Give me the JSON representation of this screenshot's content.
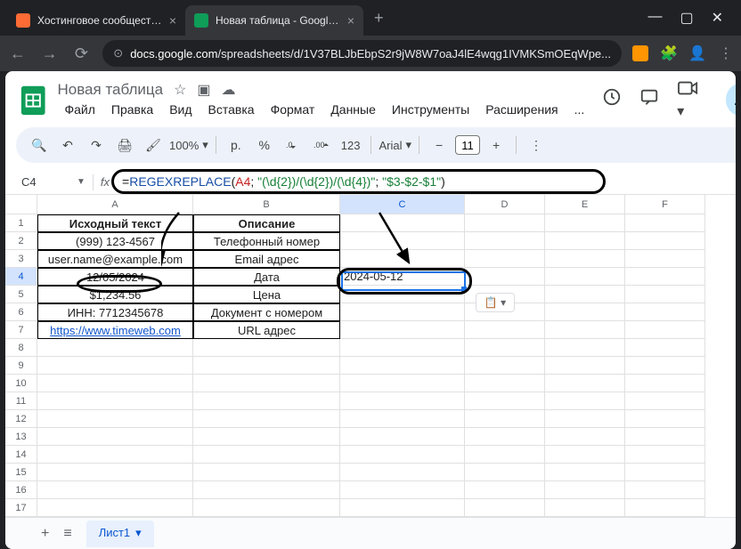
{
  "browser": {
    "tabs": [
      {
        "title": "Хостинговое сообщество «Tim...",
        "favicon_color": "#ff6b35"
      },
      {
        "title": "Новая таблица - Google Табли...",
        "favicon_color": "#0f9d58"
      }
    ],
    "url_prefix": "docs.google.com",
    "url_rest": "/spreadsheets/d/1V37BLJbEbpS2r9jW8W7oaJ4lE4wqg1IVMKSmOEqWpe..."
  },
  "doc": {
    "title": "Новая таблица",
    "menus": [
      "Файл",
      "Правка",
      "Вид",
      "Вставка",
      "Формат",
      "Данные",
      "Инструменты",
      "Расширения",
      "..."
    ]
  },
  "toolbar": {
    "zoom": "100%",
    "currency": "р.",
    "percent": "%",
    "dec_dec": ".0",
    "dec_inc": ".00",
    "format_123": "123",
    "font": "Arial",
    "size": "11"
  },
  "fbar": {
    "cell_ref": "C4",
    "formula_parts": {
      "eq": "=",
      "fn": "REGEXREPLACE",
      "open": "(",
      "ref": "A4",
      "sep1": "; ",
      "str1": "\"(\\d{2})/(\\d{2})/(\\d{4})\"",
      "sep2": "; ",
      "str2": "\"$3-$2-$1\"",
      "close": ")"
    }
  },
  "grid": {
    "cols": [
      "A",
      "B",
      "C",
      "D",
      "E",
      "F"
    ],
    "selected_col_idx": 2,
    "selected_row": 4,
    "row_count": 18,
    "headers": [
      "Исходный текст",
      "Описание"
    ],
    "rows": [
      {
        "a": "(999) 123-4567",
        "b": "Телефонный номер"
      },
      {
        "a": "user.name@example.com",
        "b": "Email адрес"
      },
      {
        "a": "12/05/2024",
        "b": "Дата"
      },
      {
        "a": "$1,234.56",
        "b": "Цена"
      },
      {
        "a": "ИНН: 7712345678",
        "b": "Документ с номером"
      },
      {
        "a": "https://www.timeweb.com",
        "b": "URL адрес",
        "link": true
      }
    ],
    "result_cell": "2024-05-12",
    "paste_hint": "📋 ▾"
  },
  "sheets": {
    "active": "Лист1"
  }
}
